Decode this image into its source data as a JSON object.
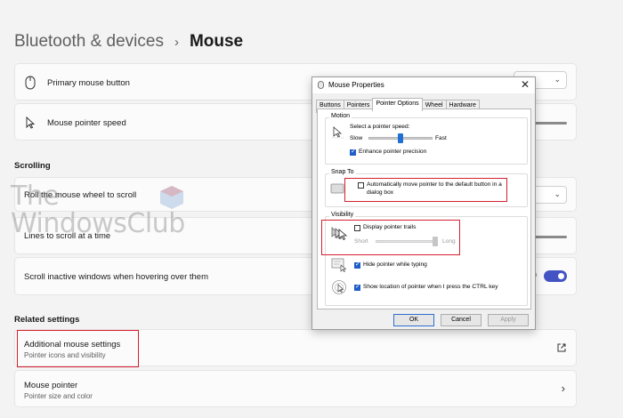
{
  "breadcrumb": {
    "parent": "Bluetooth & devices",
    "separator": "›",
    "current": "Mouse"
  },
  "cards": {
    "primary_button": {
      "label": "Primary mouse button"
    },
    "pointer_speed": {
      "label": "Mouse pointer speed"
    },
    "scroll_wheel": {
      "label": "Roll the mouse wheel to scroll",
      "value_fragment": "me"
    },
    "lines_to_scroll": {
      "label": "Lines to scroll at a time"
    },
    "scroll_inactive": {
      "label": "Scroll inactive windows when hovering over them",
      "toggle_fragment": "n",
      "toggle_on": true
    },
    "additional_mouse": {
      "label": "Additional mouse settings",
      "sub": "Pointer icons and visibility"
    },
    "mouse_pointer": {
      "label": "Mouse pointer",
      "sub": "Pointer size and color"
    }
  },
  "sections": {
    "scrolling": "Scrolling",
    "related": "Related settings"
  },
  "watermark": {
    "line1": "The",
    "line2": "WindowsClub"
  },
  "dialog": {
    "title": "Mouse Properties",
    "tabs": [
      "Buttons",
      "Pointers",
      "Pointer Options",
      "Wheel",
      "Hardware"
    ],
    "active_tab": "Pointer Options",
    "motion": {
      "group": "Motion",
      "prompt": "Select a pointer speed:",
      "slow": "Slow",
      "fast": "Fast",
      "speed_level": 0.5,
      "enhance_label": "Enhance pointer precision",
      "enhance_checked": true
    },
    "snap_to": {
      "group": "Snap To",
      "line1": "Automatically move pointer to the default button in a",
      "line2": "dialog box",
      "checked": false
    },
    "visibility": {
      "group": "Visibility",
      "trails_label": "Display pointer trails",
      "trails_checked": false,
      "short": "Short",
      "long": "Long",
      "trails_level": 1.0,
      "hide_label": "Hide pointer while typing",
      "hide_checked": true,
      "ctrl_label": "Show location of pointer when I press the CTRL key",
      "ctrl_checked": true
    },
    "buttons": {
      "ok": "OK",
      "cancel": "Cancel",
      "apply": "Apply"
    }
  },
  "colors": {
    "accent": "#4453c4",
    "highlight": "#d31f2e",
    "dialog_accent": "#1f6fd6"
  }
}
